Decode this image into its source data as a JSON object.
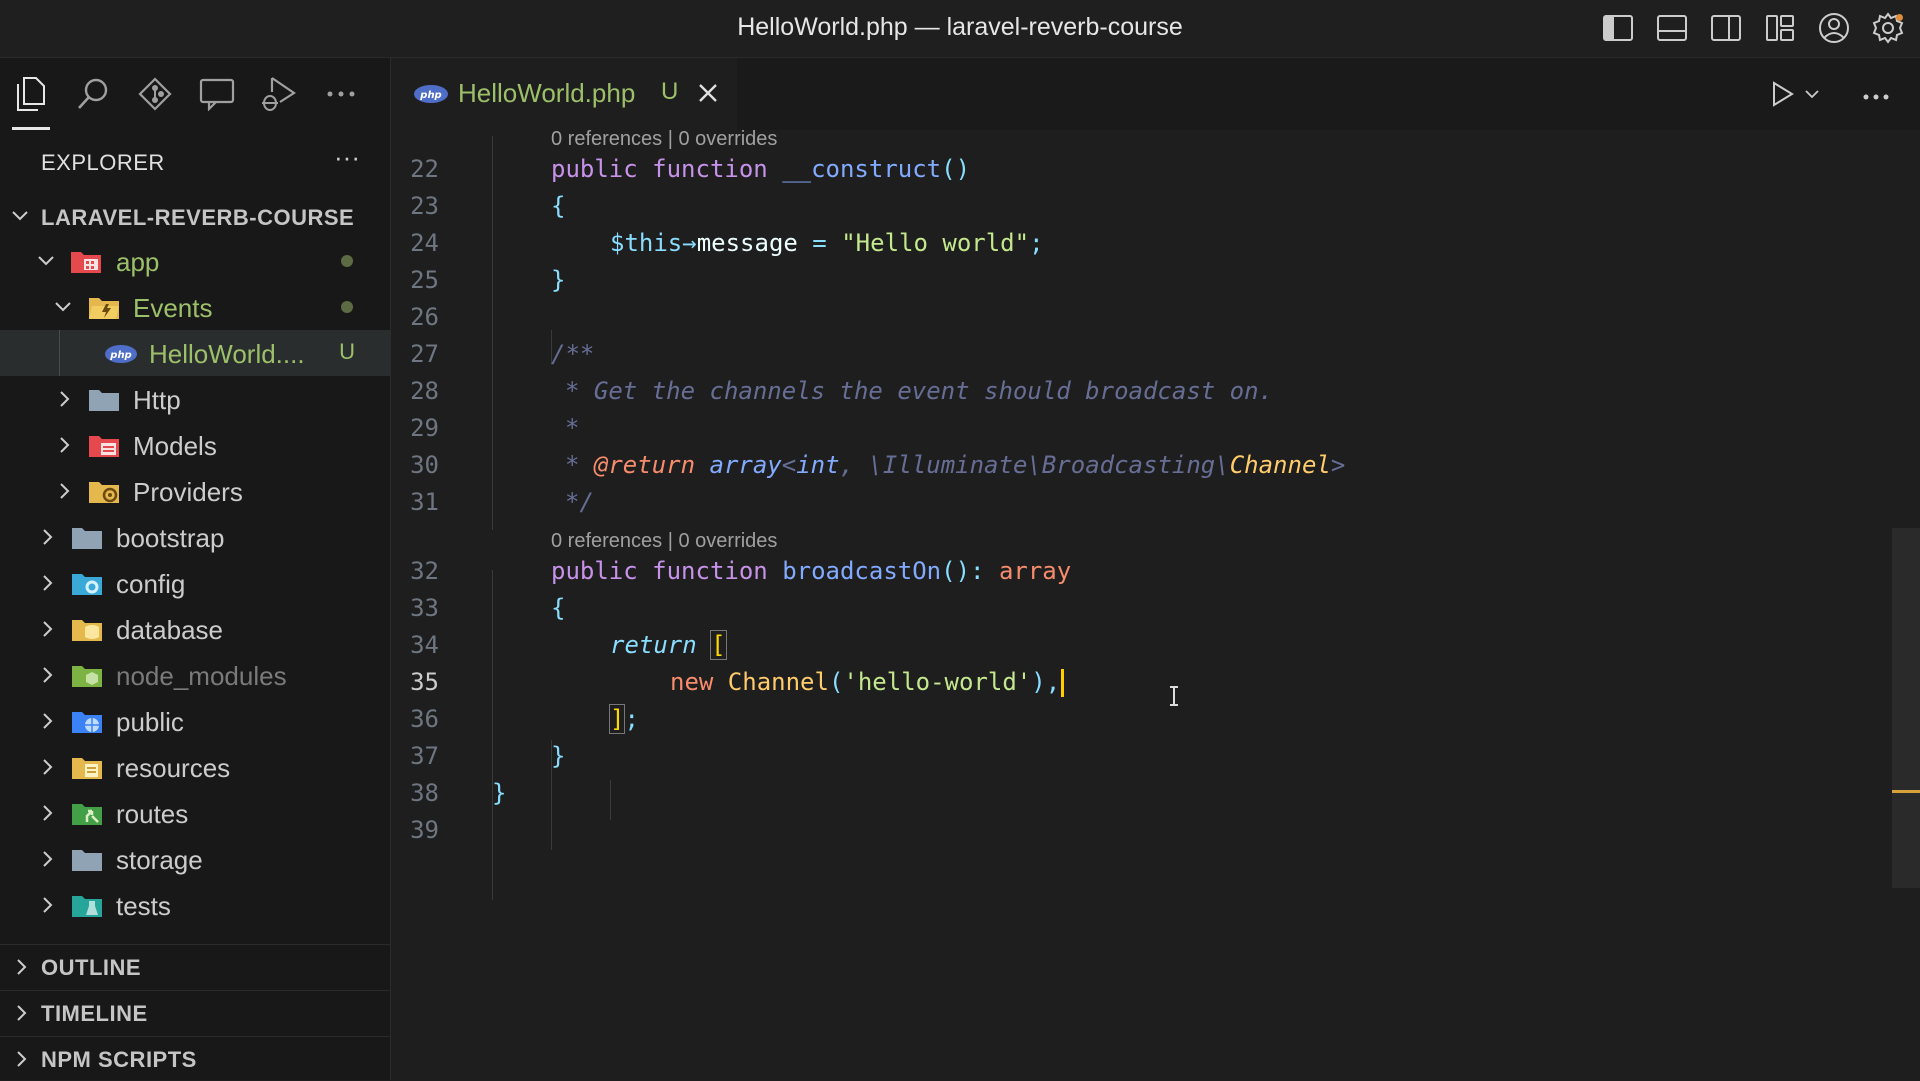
{
  "window": {
    "title": "HelloWorld.php — laravel-reverb-course"
  },
  "title_actions": [
    "toggle-primary-sidebar-icon",
    "toggle-panel-icon",
    "toggle-secondary-sidebar-icon",
    "customize-layout-icon",
    "account-icon",
    "settings-gear-icon"
  ],
  "activity_bar": [
    "explorer-icon",
    "search-icon",
    "source-control-icon",
    "remote-explorer-icon",
    "run-debug-icon",
    "more-icon"
  ],
  "explorer": {
    "header": "EXPLORER",
    "more": "···",
    "project": "LARAVEL-REVERB-COURSE",
    "tree": [
      {
        "name": "app",
        "expanded": true,
        "modified": true
      },
      {
        "name": "Events",
        "expanded": true,
        "modified": true
      },
      {
        "name": "HelloWorld....",
        "status": "U"
      },
      {
        "name": "Http"
      },
      {
        "name": "Models"
      },
      {
        "name": "Providers"
      },
      {
        "name": "bootstrap"
      },
      {
        "name": "config"
      },
      {
        "name": "database"
      },
      {
        "name": "node_modules"
      },
      {
        "name": "public"
      },
      {
        "name": "resources"
      },
      {
        "name": "routes"
      },
      {
        "name": "storage"
      },
      {
        "name": "tests"
      }
    ],
    "sections": [
      "OUTLINE",
      "TIMELINE",
      "NPM SCRIPTS"
    ]
  },
  "tab": {
    "name": "HelloWorld.php",
    "status": "U",
    "icon_text": "php"
  },
  "codelens": {
    "text": "0 references | 0 overrides"
  },
  "code": {
    "line_numbers": [
      "22",
      "23",
      "24",
      "25",
      "26",
      "27",
      "28",
      "29",
      "30",
      "31",
      "32",
      "33",
      "34",
      "35",
      "36",
      "37",
      "38",
      "39"
    ],
    "l22": {
      "kw": "public function ",
      "fn": "__construct",
      "p": "()"
    },
    "l23": "{",
    "l24": {
      "var": "$this",
      "arrow": "→",
      "prop": "message",
      "eq": " = ",
      "str": "\"Hello world\"",
      "semi": ";"
    },
    "l25": "}",
    "l27": "/**",
    "l28": "* Get the channels the event should broadcast on.",
    "l29": "*",
    "l30": {
      "star": "* ",
      "tag": "@return ",
      "type": "array",
      "lt": "<",
      "int": "int",
      "rest": ", \\Illuminate\\Broadcasting\\",
      "cls": "Channel",
      "gt": ">"
    },
    "l31": "*/",
    "l32": {
      "kw": "public function ",
      "fn": "broadcastOn",
      "p": "(): ",
      "ret": "array"
    },
    "l33": "{",
    "l34": {
      "ret": "return ",
      "br": "["
    },
    "l35": {
      "new": "new ",
      "cls": "Channel",
      "p1": "(",
      "str": "'hello-world'",
      "p2": "),"
    },
    "l36": {
      "br": "]",
      "semi": ";"
    },
    "l37": "}",
    "l38": "}"
  },
  "colors": {
    "accent": "#3a8ee6",
    "untracked": "#9cc06a",
    "caret": "#ffcc00"
  }
}
